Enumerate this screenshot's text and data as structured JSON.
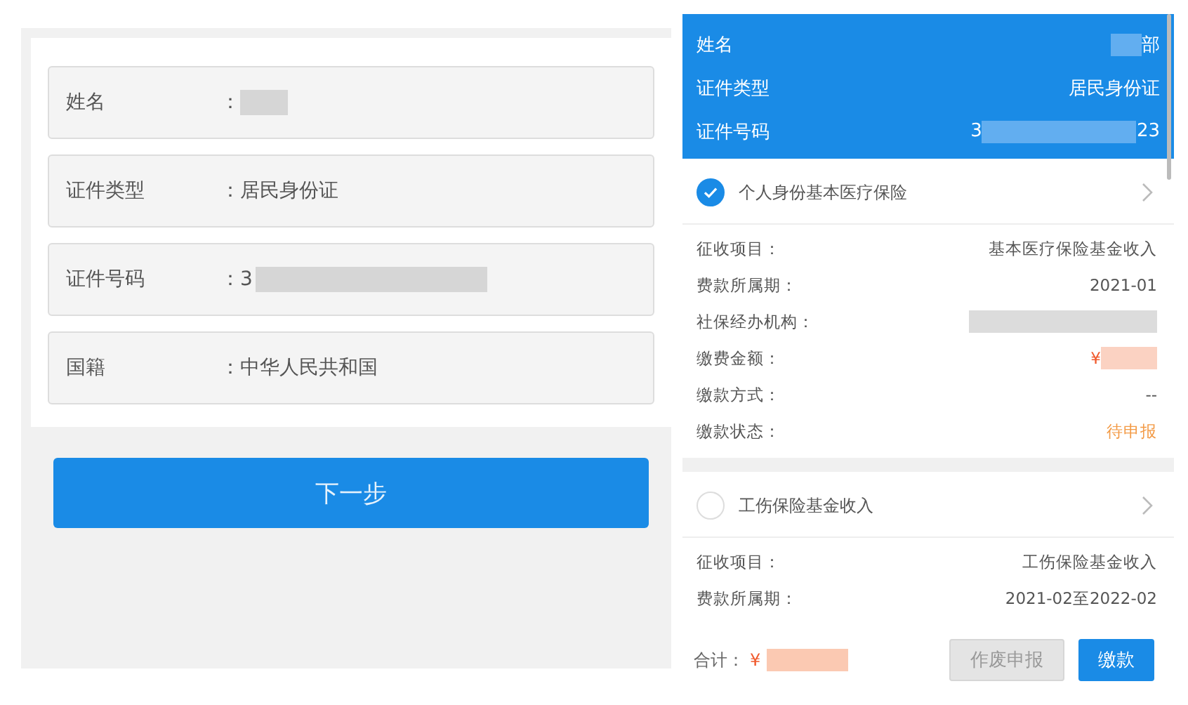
{
  "identity_form": {
    "fields": [
      {
        "label": "姓名",
        "separator": "：",
        "redacted": true
      },
      {
        "label": "证件类型",
        "separator": "：",
        "value": "居民身份证"
      },
      {
        "label": "证件号码",
        "separator": "：",
        "value": "3",
        "redacted": true
      },
      {
        "label": "国籍",
        "separator": "：",
        "value": "中华人民共和国"
      }
    ],
    "next_button": "下一步"
  },
  "payment_screen": {
    "header": [
      {
        "label": "姓名",
        "redacted": true,
        "suffix": "部"
      },
      {
        "label": "证件类型",
        "value": "居民身份证"
      },
      {
        "label": "证件号码",
        "value": "3",
        "redacted": true,
        "suffix": "23"
      }
    ],
    "items": [
      {
        "title": "个人身份基本医疗保险",
        "selected": true,
        "details": [
          {
            "label": "征收项目：",
            "kind": "text",
            "value": "基本医疗保险基金收入"
          },
          {
            "label": "费款所属期：",
            "kind": "text",
            "value": "2021-01"
          },
          {
            "label": "社保经办机构：",
            "kind": "redacted"
          },
          {
            "label": "缴费金额：",
            "kind": "amount",
            "value": "¥"
          },
          {
            "label": "缴款方式：",
            "kind": "text",
            "value": "--"
          },
          {
            "label": "缴款状态：",
            "kind": "status",
            "value": "待申报"
          }
        ]
      },
      {
        "title": "工伤保险基金收入",
        "selected": false,
        "details": [
          {
            "label": "征收项目：",
            "kind": "text",
            "value": "工伤保险基金收入"
          },
          {
            "label": "费款所属期：",
            "kind": "text",
            "value": "2021-02至2022-02"
          }
        ]
      }
    ],
    "footer": {
      "total_label": "合计：",
      "total_value": "¥",
      "buttons": [
        {
          "label": "作废申报",
          "disabled": true
        },
        {
          "label": "缴款",
          "disabled": false
        }
      ]
    }
  }
}
